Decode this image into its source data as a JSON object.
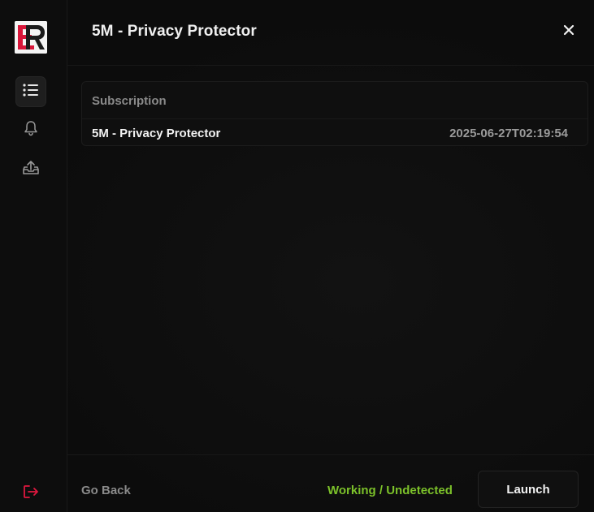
{
  "window": {
    "title": "5M - Privacy Protector"
  },
  "sidebar": {
    "logo_icon": "er-logo",
    "items": [
      {
        "icon": "list-icon",
        "active": true
      },
      {
        "icon": "bell-icon",
        "active": false
      },
      {
        "icon": "upload-icon",
        "active": false
      }
    ],
    "logout_icon": "logout-icon"
  },
  "table": {
    "header": "Subscription",
    "rows": [
      {
        "name": "5M - Privacy Protector",
        "expires": "2025-06-27T02:19:54"
      }
    ]
  },
  "footer": {
    "back_label": "Go Back",
    "status_text": "Working / Undetected",
    "launch_label": "Launch"
  },
  "colors": {
    "accent_red": "#e0183f",
    "status_green": "#7cc12a",
    "background": "#0c0c0c"
  }
}
